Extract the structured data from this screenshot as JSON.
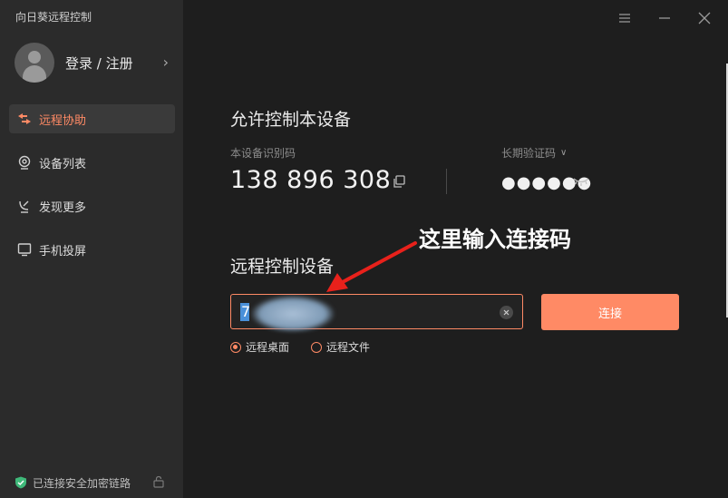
{
  "app": {
    "title": "向日葵远程控制"
  },
  "user": {
    "login_label": "登录 / 注册"
  },
  "sidebar": {
    "items": [
      {
        "label": "远程协助",
        "icon": "remote-assist-icon",
        "active": true
      },
      {
        "label": "设备列表",
        "icon": "device-list-icon",
        "active": false
      },
      {
        "label": "发现更多",
        "icon": "discover-icon",
        "active": false
      },
      {
        "label": "手机投屏",
        "icon": "screen-cast-icon",
        "active": false
      }
    ],
    "status": "已连接安全加密链路"
  },
  "allow_control": {
    "title": "允许控制本设备",
    "id_label": "本设备识别码",
    "id_value": "138 896 308",
    "password_label": "长期验证码",
    "password_value": "●●●●●●"
  },
  "remote_control": {
    "title": "远程控制设备",
    "input_value": "7",
    "connect_label": "连接",
    "options": [
      {
        "label": "远程桌面",
        "checked": true
      },
      {
        "label": "远程文件",
        "checked": false
      }
    ]
  },
  "annotation": {
    "text": "这里输入连接码"
  },
  "colors": {
    "accent": "#ff8a65",
    "sidebar_bg": "#2b2b2b",
    "main_bg": "#1e1e1e",
    "annotation_arrow": "#e8211b"
  }
}
